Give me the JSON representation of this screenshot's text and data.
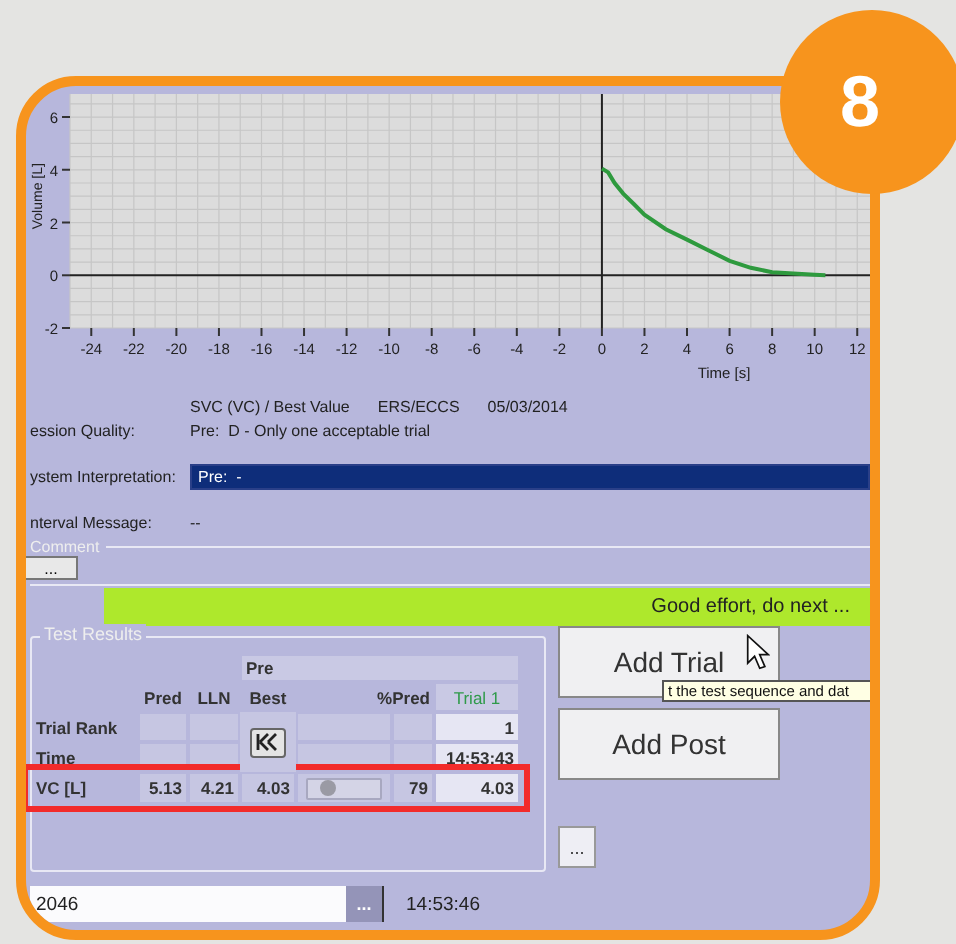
{
  "badge": "8",
  "chart": {
    "chart_data": {
      "type": "line",
      "xlabel": "Time  [s]",
      "ylabel": "Volume [L]",
      "grid": true,
      "xlim": [
        -25,
        12.6
      ],
      "ylim": [
        -2,
        6.8
      ],
      "xticks": [
        -24,
        -22,
        -20,
        -18,
        -16,
        -14,
        -12,
        -10,
        -8,
        -6,
        -4,
        -2,
        0,
        2,
        4,
        6,
        8,
        10,
        12
      ],
      "yticks": [
        -2,
        0,
        2,
        4,
        6
      ],
      "x": [
        0,
        0.3,
        0.6,
        1,
        1.5,
        2,
        3,
        4,
        5,
        6,
        7,
        8,
        9,
        10,
        10.5
      ],
      "series": [
        {
          "color": "#2e9a3e",
          "values": [
            4.05,
            3.9,
            3.5,
            3.1,
            2.7,
            2.3,
            1.75,
            1.35,
            0.95,
            0.55,
            0.28,
            0.12,
            0.06,
            0.02,
            0
          ]
        }
      ]
    }
  },
  "header": {
    "test": "SVC (VC) / Best Value",
    "standard": "ERS/ECCS",
    "date": "05/03/2014"
  },
  "fields": [
    {
      "label": "ession Quality:",
      "value": "Pre:  D - Only one acceptable trial",
      "kind": "text"
    },
    {
      "label": "ystem Interpretation:",
      "value": "Pre:  -",
      "kind": "bar"
    }
  ],
  "interval_message": {
    "label": "nterval Message:",
    "text": "--"
  },
  "comment": {
    "legend": "Comment",
    "button": "..."
  },
  "message": "Good effort, do next ...",
  "results": {
    "legend": "Test Results",
    "group": "Pre",
    "columns": [
      "Pred",
      "LLN",
      "Best",
      "%Pred",
      "Trial 1"
    ],
    "rows": [
      {
        "label": "Trial Rank",
        "trial": "1"
      },
      {
        "label": "Time",
        "trial": "14:53:43"
      },
      {
        "label": "VC [L]",
        "pred": "5.13",
        "lln": "4.21",
        "best": "4.03",
        "level": 0.28,
        "pct": "79",
        "trial": "4.03",
        "highlighted": true
      }
    ]
  },
  "buttons": [
    "Add Trial",
    "Add Post"
  ],
  "tooltip": "t the test sequence and dat",
  "more_button": "...",
  "footer": {
    "value": "2046",
    "button": "...",
    "time": "14:53:46"
  }
}
